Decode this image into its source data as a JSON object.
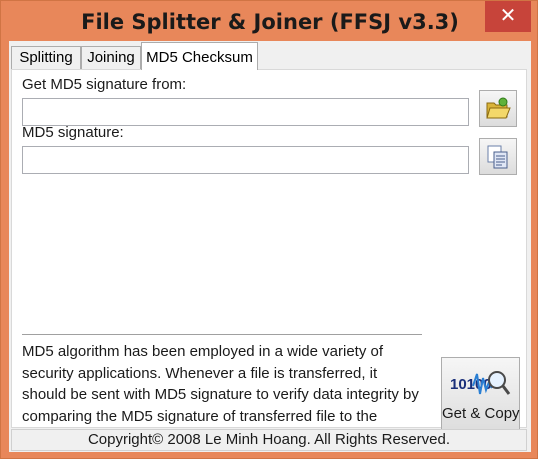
{
  "window": {
    "title": "File Splitter & Joiner (FFSJ v3.3)",
    "close_glyph": "✕"
  },
  "tabs": [
    {
      "label": "Splitting",
      "active": false
    },
    {
      "label": "Joining",
      "active": false
    },
    {
      "label": "MD5 Checksum",
      "active": true
    }
  ],
  "md5": {
    "source_label": "Get MD5 signature from:",
    "source_value": "",
    "signature_label": "MD5 signature:",
    "signature_value": "",
    "description": "MD5 algorithm has been employed in a wide variety of security applications. Whenever a file is transferred, it should be sent with MD5 signature to verify data integrity by comparing the MD5 signature of transferred file to the authentic signature.",
    "get_copy_label": "Get & Copy",
    "get_copy_icon_text": "10100"
  },
  "icons": {
    "browse": "open-folder-icon",
    "copy": "copy-documents-icon",
    "get_copy": "binary-waveform-magnifier-icon"
  },
  "status": {
    "copyright": "Copyright© 2008 Le Minh Hoang. All Rights Reserved."
  },
  "colors": {
    "frame": "#e8875a",
    "close_button": "#c7443a",
    "client_background": "#f0f0f0"
  }
}
